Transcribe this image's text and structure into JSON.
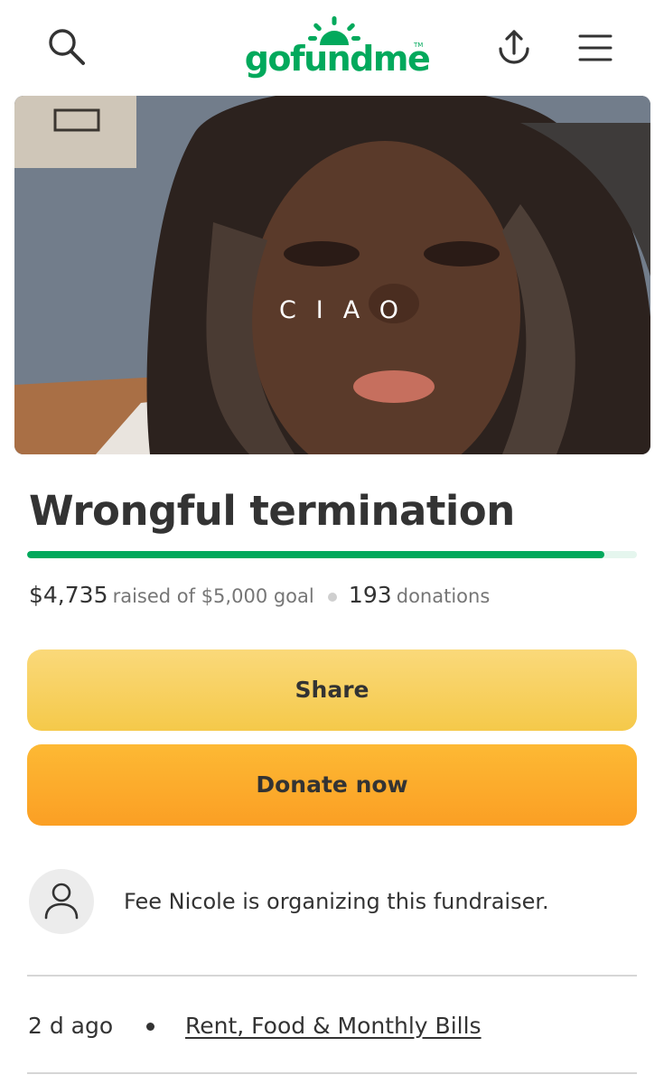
{
  "header": {
    "logo_text": "gofundme",
    "logo_tm": "TM",
    "brand_color": "#02a95c",
    "icons": [
      "search-icon",
      "share-upload-icon",
      "hamburger-menu-icon"
    ]
  },
  "hero": {
    "caption": "CIAO"
  },
  "campaign": {
    "title": "Wrongful termination",
    "raised": "$4,735",
    "raised_suffix": "raised of $5,000 goal",
    "donations_count": "193",
    "donations_label": "donations",
    "progress_fraction": 0.947
  },
  "actions": {
    "share_label": "Share",
    "donate_label": "Donate now",
    "share_color": "#f5c94a",
    "donate_color": "#fb9f24"
  },
  "organizer": {
    "text": "Fee Nicole is organizing this fundraiser."
  },
  "meta": {
    "time_ago": "2 d ago",
    "category": "Rent, Food & Monthly Bills"
  }
}
